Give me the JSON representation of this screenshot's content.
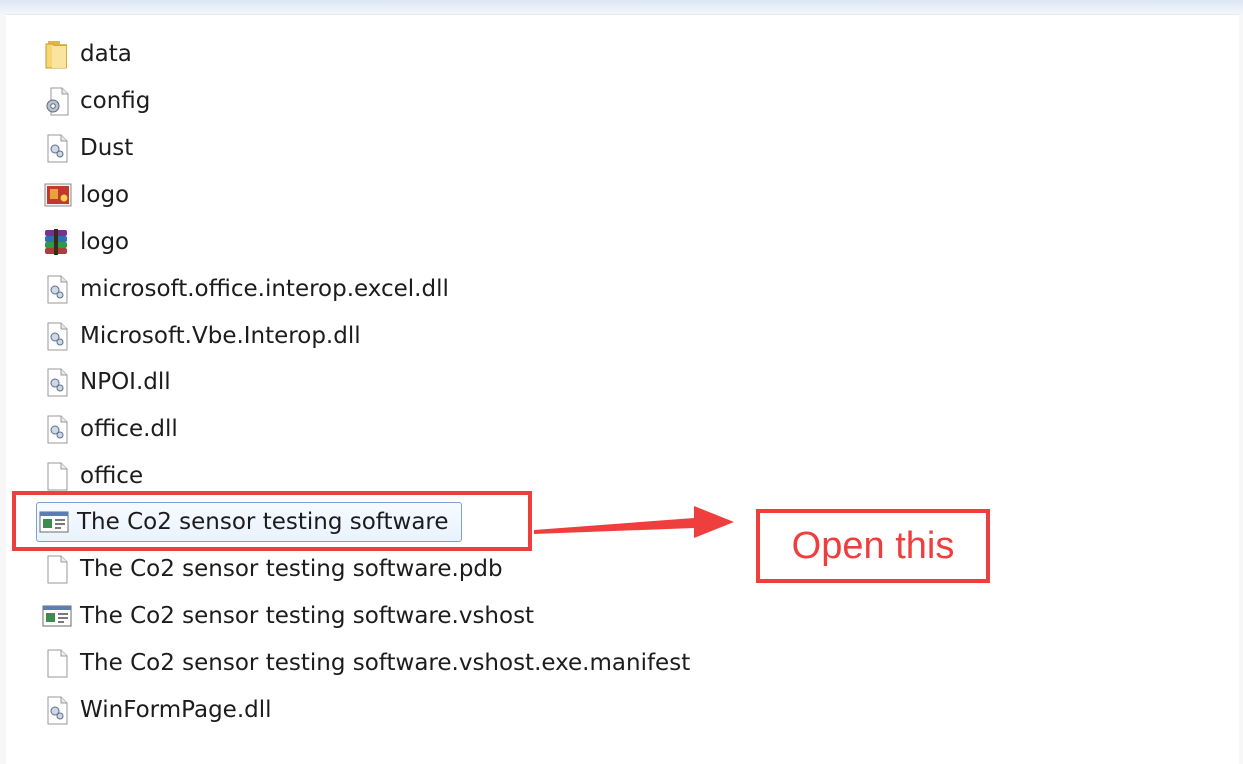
{
  "files": [
    {
      "name": "data",
      "icon": "folder-icon"
    },
    {
      "name": "config",
      "icon": "config-file-icon"
    },
    {
      "name": "Dust",
      "icon": "dll-file-icon"
    },
    {
      "name": "logo",
      "icon": "image-file-icon"
    },
    {
      "name": "logo",
      "icon": "winrar-archive-icon"
    },
    {
      "name": "microsoft.office.interop.excel.dll",
      "icon": "dll-file-icon"
    },
    {
      "name": "Microsoft.Vbe.Interop.dll",
      "icon": "dll-file-icon"
    },
    {
      "name": "NPOI.dll",
      "icon": "dll-file-icon"
    },
    {
      "name": "office.dll",
      "icon": "dll-file-icon"
    },
    {
      "name": "office",
      "icon": "blank-file-icon"
    },
    {
      "name": "The Co2 sensor testing software",
      "icon": "application-icon",
      "selected": true
    },
    {
      "name": "The Co2 sensor testing software.pdb",
      "icon": "blank-file-icon"
    },
    {
      "name": "The Co2 sensor testing software.vshost",
      "icon": "application-icon"
    },
    {
      "name": "The Co2 sensor testing software.vshost.exe.manifest",
      "icon": "blank-file-icon"
    },
    {
      "name": "WinFormPage.dll",
      "icon": "dll-file-icon"
    }
  ],
  "annotation": {
    "callout_text": "Open this",
    "color": "#ee3e3e"
  }
}
